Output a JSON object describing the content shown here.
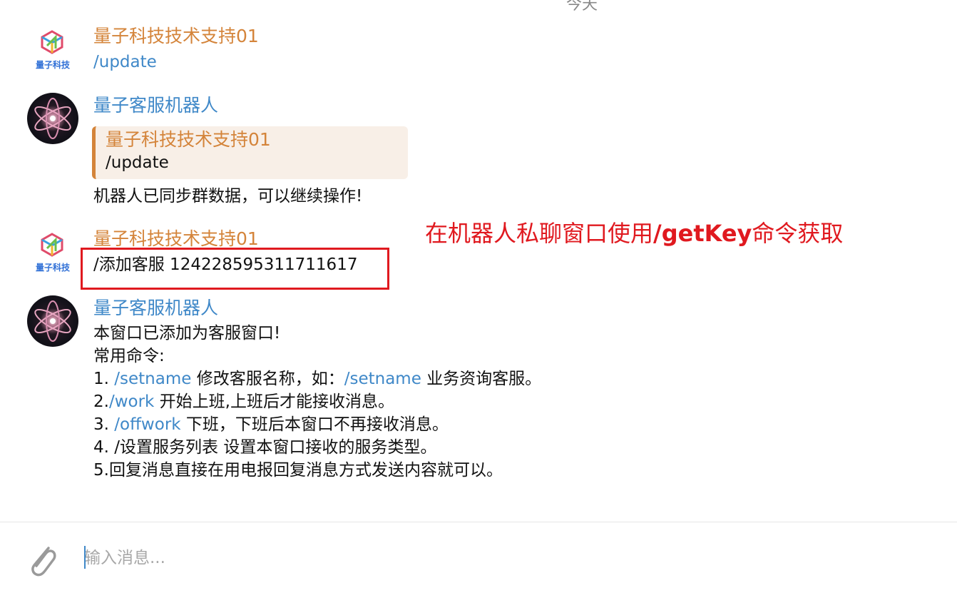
{
  "top_cut_text": "今天",
  "messages": [
    {
      "sender": "量子科技技术支持01",
      "avatar_text": "量子科技",
      "text": "/update"
    },
    {
      "sender": "量子客服机器人",
      "reply": {
        "sender": "量子科技技术支持01",
        "text": "/update"
      },
      "text": "机器人已同步群数据，可以继续操作!"
    },
    {
      "sender": "量子科技技术支持01",
      "avatar_text": "量子科技",
      "text": "/添加客服 1242285953117116​17"
    },
    {
      "sender": "量子客服机器人",
      "lines": [
        {
          "plain": "本窗口已添加为客服窗口!"
        },
        {
          "plain": "常用命令:"
        },
        {
          "pre": "1. ",
          "cmd": "/setname",
          "mid": " 修改客服名称，如：",
          "cmd2": "/setname",
          "post": " 业务资询客服。"
        },
        {
          "pre": "2.",
          "cmd": "/work",
          "post": " 开始上班,上班后才能接收消息。"
        },
        {
          "pre": "3. ",
          "cmd": "/offwork",
          "post": " 下班，下班后本窗口不再接收消息。"
        },
        {
          "plain": "4. /设置服务列表 设置本窗口接收的服务类型。"
        },
        {
          "plain": "5.回复消息直接在用电报回复消息方式发送内容就可以。"
        }
      ]
    }
  ],
  "annotation": {
    "pre": "在机器人私聊窗口使用",
    "bold": "/getKey",
    "post": "命令获取"
  },
  "composer": {
    "placeholder": "输入消息..."
  },
  "colors": {
    "accent_blue": "#3f88c8",
    "sender_orange": "#d4843a",
    "annotation_red": "#e0191f"
  },
  "icons": {
    "attach": "paperclip-icon",
    "company_logo": "quantum-logo-icon",
    "bot_avatar": "atom-icon"
  }
}
